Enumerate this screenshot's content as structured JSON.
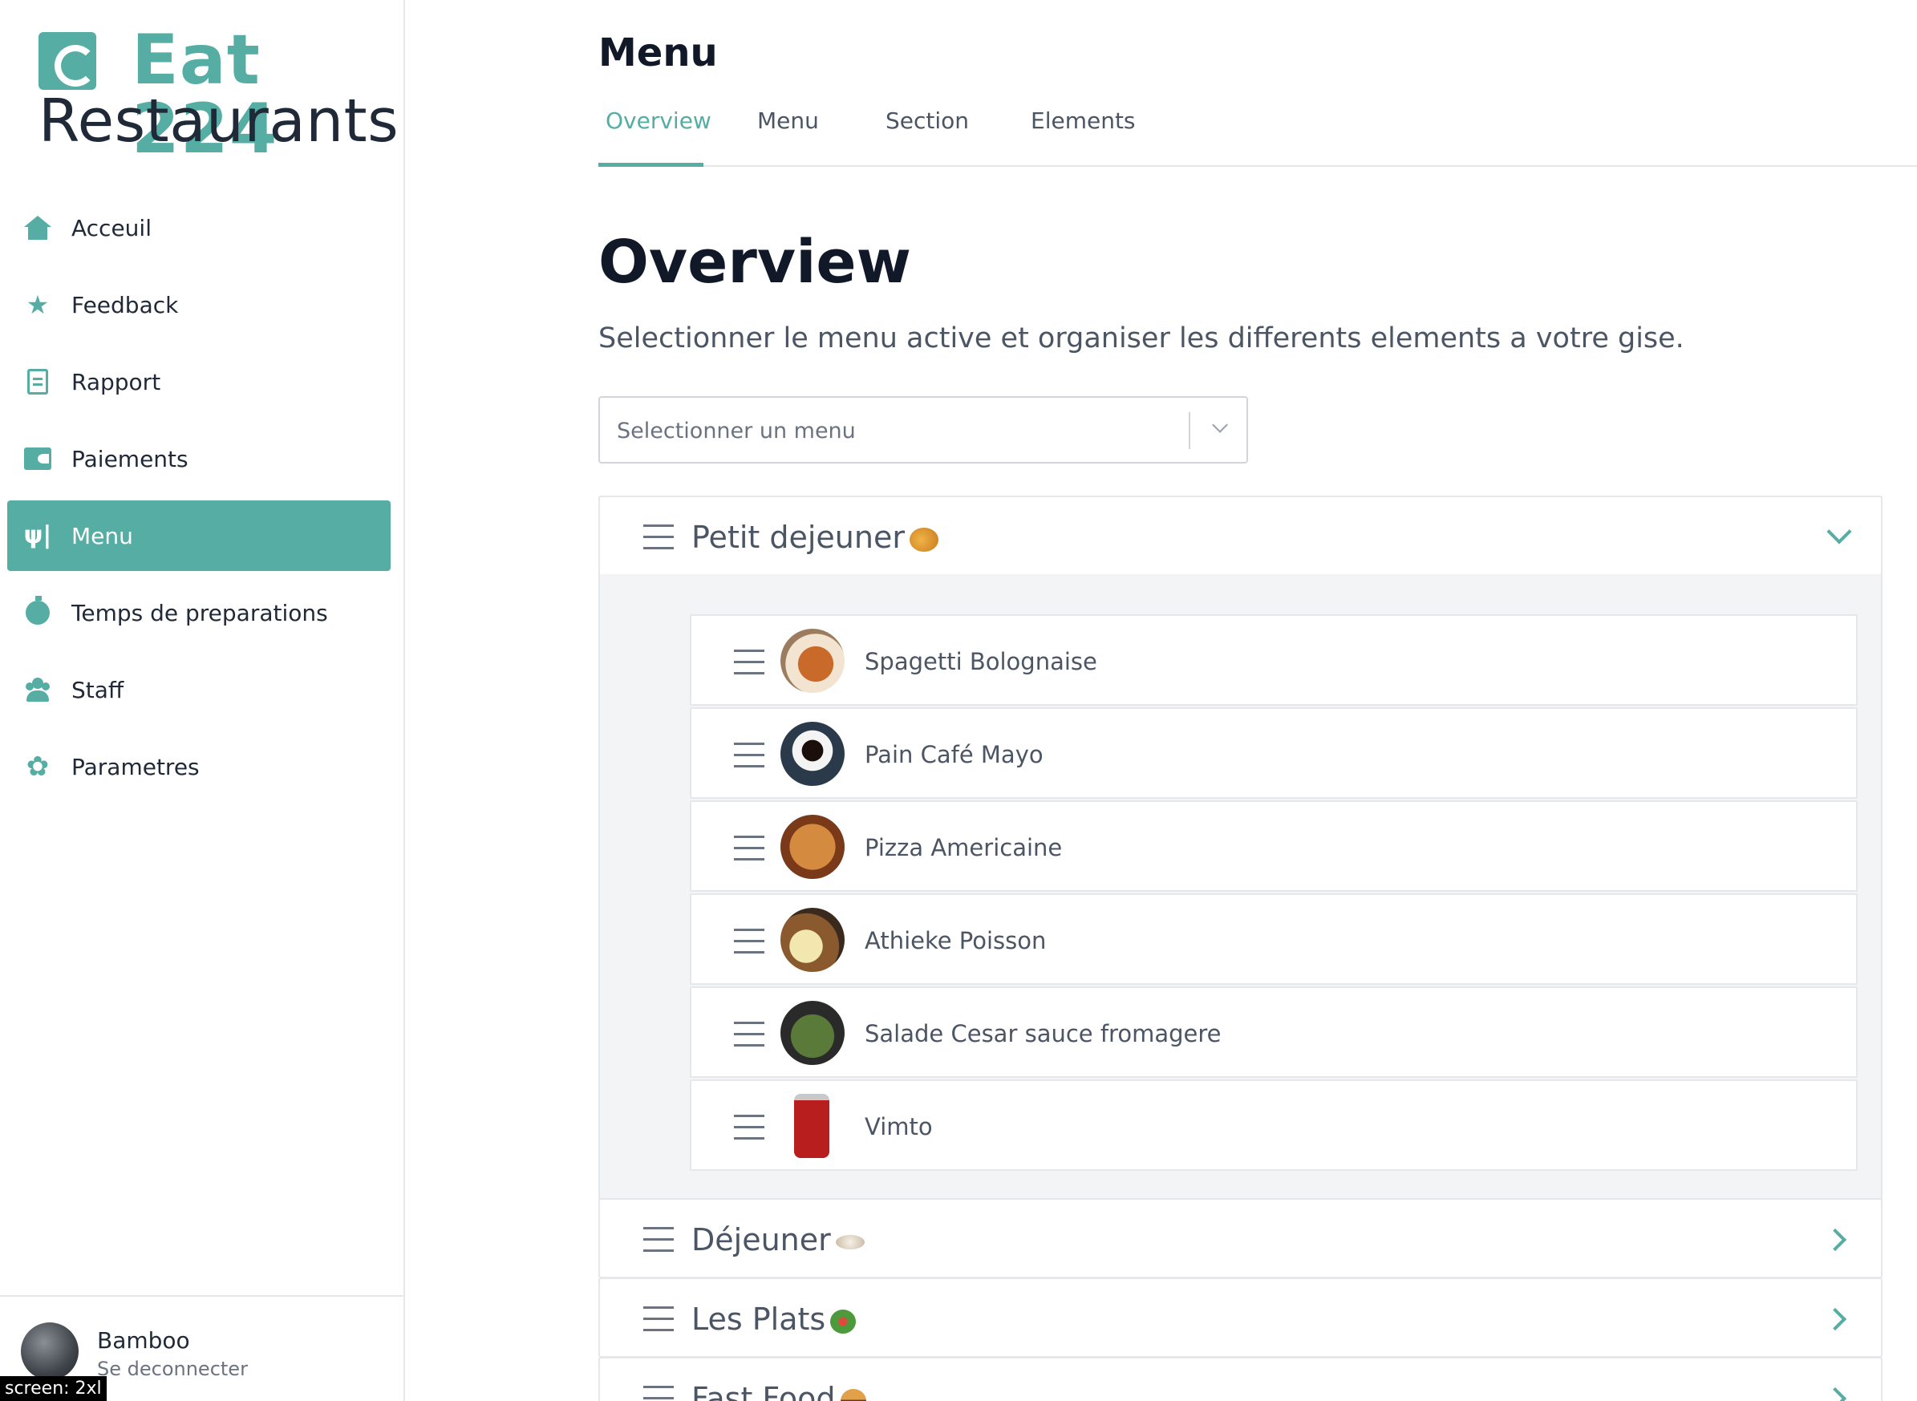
{
  "sidebar": {
    "logo": {
      "brand": "Eat 224",
      "sub": "Restaurants"
    },
    "items": [
      {
        "label": "Acceuil",
        "icon": "home-icon"
      },
      {
        "label": "Feedback",
        "icon": "star-icon"
      },
      {
        "label": "Rapport",
        "icon": "document-icon"
      },
      {
        "label": "Paiements",
        "icon": "wallet-icon"
      },
      {
        "label": "Menu",
        "icon": "fork-knife-icon",
        "active": true
      },
      {
        "label": "Temps de preparations",
        "icon": "timer-icon"
      },
      {
        "label": "Staff",
        "icon": "people-icon"
      },
      {
        "label": "Parametres",
        "icon": "gear-icon"
      }
    ],
    "user": {
      "name": "Bamboo",
      "logout": "Se deconnecter"
    }
  },
  "screen_tag": "screen: 2xl",
  "header": {
    "title": "Menu",
    "tabs": [
      {
        "label": "Overview",
        "active": true
      },
      {
        "label": "Menu"
      },
      {
        "label": "Section"
      },
      {
        "label": "Elements"
      }
    ]
  },
  "main": {
    "heading": "Overview",
    "description": "Selectionner le menu active et organiser les differents elements a votre gise.",
    "select": {
      "placeholder": "Selectionner un menu"
    },
    "sections": [
      {
        "title": "Petit dejeuner",
        "emoji": "croissant",
        "expanded": true,
        "items": [
          {
            "name": "Spagetti Bolognaise"
          },
          {
            "name": "Pain Café Mayo"
          },
          {
            "name": "Pizza Americaine"
          },
          {
            "name": "Athieke Poisson"
          },
          {
            "name": "Salade Cesar sauce fromagere"
          },
          {
            "name": "Vimto"
          }
        ]
      },
      {
        "title": "Déjeuner",
        "emoji": "bowl",
        "expanded": false
      },
      {
        "title": "Les Plats",
        "emoji": "salad",
        "expanded": false
      },
      {
        "title": "Fast Food",
        "emoji": "burger",
        "expanded": false
      }
    ]
  },
  "colors": {
    "accent": "#55ada4",
    "text": "#1f2937",
    "muted": "#4b5563",
    "panel": "#f3f4f6"
  }
}
